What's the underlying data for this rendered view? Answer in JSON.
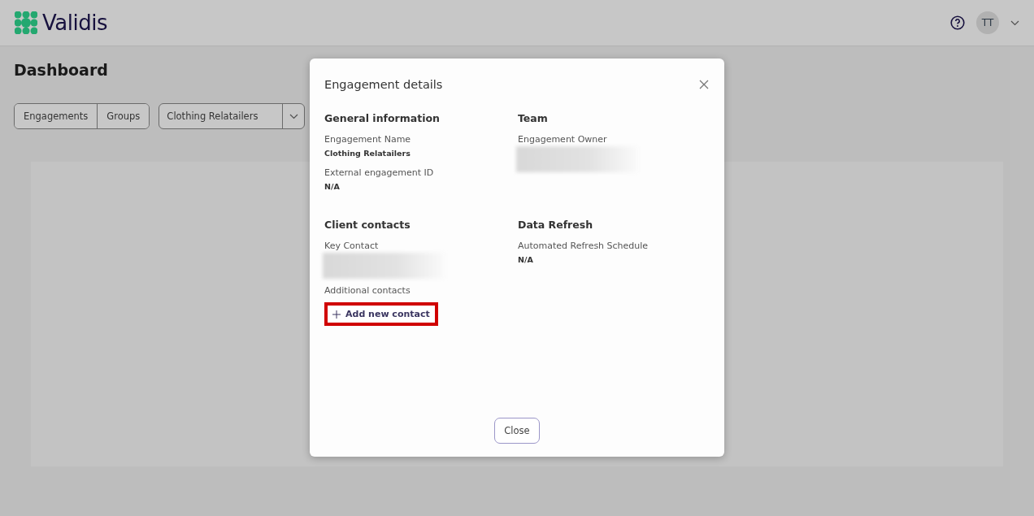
{
  "header": {
    "logo": "Validis",
    "avatar": "TT"
  },
  "page": {
    "title": "Dashboard",
    "view_toggle": [
      "Engagements",
      "Groups"
    ],
    "engagement_select": {
      "value": "Clothing Relatailers"
    }
  },
  "dialog": {
    "title": "Engagement details",
    "sections": [
      {
        "heading": "General information",
        "fields": [
          {
            "label": "Engagement Name",
            "value": "Clothing Relatailers"
          },
          {
            "label": "External engagement ID",
            "value": "N/A"
          }
        ]
      },
      {
        "heading": "Team",
        "fields": [
          {
            "label": "Engagement Owner",
            "redacted": true
          }
        ]
      },
      {
        "heading": "Client contacts",
        "fields": [
          {
            "label": "Key Contact",
            "redacted": true
          },
          {
            "label": "Additional contacts"
          }
        ],
        "action": {
          "label": "Add new contact",
          "highlighted": true
        }
      },
      {
        "heading": "Data Refresh",
        "fields": [
          {
            "label": "Automated Refresh Schedule",
            "value": "N/A"
          }
        ]
      }
    ],
    "close_button": "Close"
  }
}
